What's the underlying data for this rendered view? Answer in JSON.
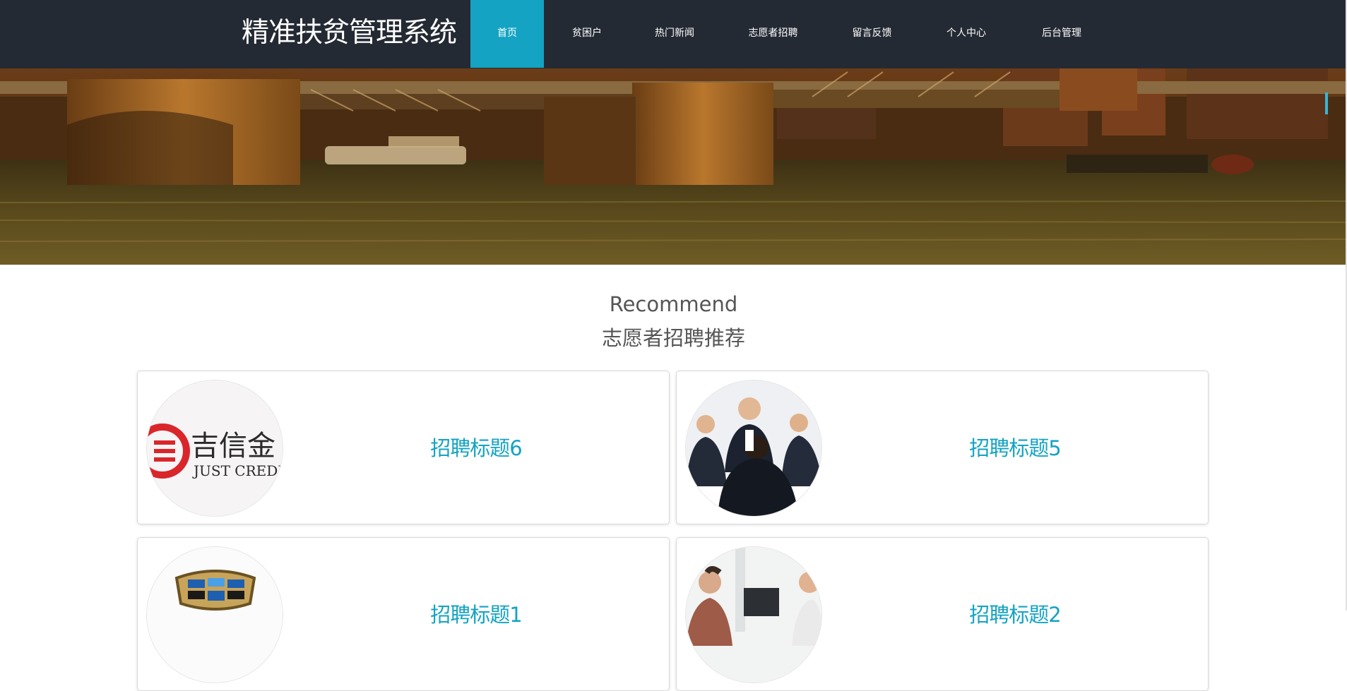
{
  "app": {
    "title": "精准扶贫管理系统"
  },
  "nav": {
    "items": [
      {
        "label": "首页",
        "active": true
      },
      {
        "label": "贫困户",
        "active": false
      },
      {
        "label": "热门新闻",
        "active": false
      },
      {
        "label": "志愿者招聘",
        "active": false
      },
      {
        "label": "留言反馈",
        "active": false
      },
      {
        "label": "个人中心",
        "active": false
      },
      {
        "label": "后台管理",
        "active": false
      }
    ]
  },
  "colors": {
    "nav_bg": "#242a33",
    "accent": "#14a3c2",
    "heading": "#555555"
  },
  "recommend": {
    "title_en": "Recommend",
    "title_zh": "志愿者招聘推荐",
    "cards": [
      {
        "title": "招聘标题6",
        "image": "logo-jixinjin",
        "logo_text": "吉信金",
        "logo_subtext": "JUST CREDIT"
      },
      {
        "title": "招聘标题5",
        "image": "business-meeting-photo"
      },
      {
        "title": "招聘标题1",
        "image": "car-emblem-logo"
      },
      {
        "title": "招聘标题2",
        "image": "office-meeting-photo"
      }
    ]
  }
}
